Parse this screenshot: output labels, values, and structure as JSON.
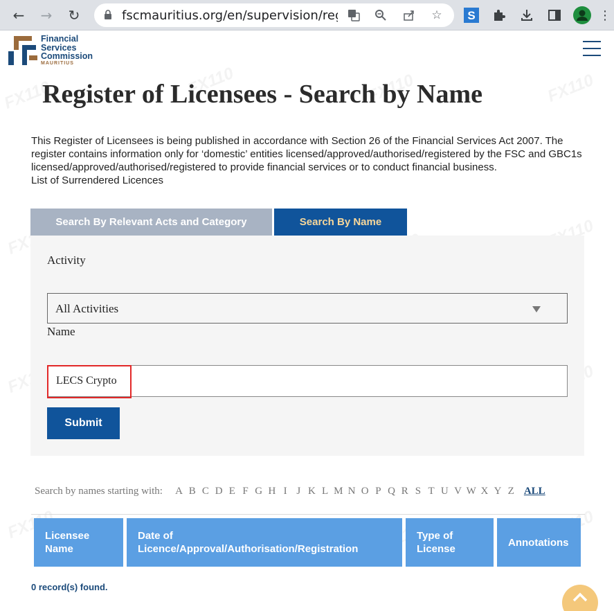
{
  "browser": {
    "url": "fscmauritius.org/en/supervision/reg..."
  },
  "header": {
    "logo_line1": "Financial",
    "logo_line2": "Services",
    "logo_line3": "Commission",
    "logo_sub": "MAURITIUS"
  },
  "page": {
    "title": "Register of Licensees - Search by Name",
    "intro": "This Register of Licensees is being published in accordance with Section 26 of the Financial Services Act 2007. The register contains information only for ‘domestic’ entities licensed/approved/authorised/registered by the FSC and GBC1s licensed/approved/authorised/registered to provide financial services or to conduct financial business.",
    "surrendered_link": "List of Surrendered Licences"
  },
  "tabs": [
    {
      "label": "Search By Relevant Acts and Category"
    },
    {
      "label": "Search By Name"
    }
  ],
  "form": {
    "activity_label": "Activity",
    "activity_value": "All Activities",
    "name_label": "Name",
    "name_value": "LECS Crypto",
    "submit_label": "Submit"
  },
  "alphabet": {
    "prefix": "Search by names starting with:",
    "letters": [
      "A",
      "B",
      "C",
      "D",
      "E",
      "F",
      "G",
      "H",
      "I",
      "J",
      "K",
      "L",
      "M",
      "N",
      "O",
      "P",
      "Q",
      "R",
      "S",
      "T",
      "U",
      "V",
      "W",
      "X",
      "Y",
      "Z"
    ],
    "all_label": "ALL"
  },
  "table": {
    "headers": [
      "Licensee Name",
      "Date of Licence/Approval/Authorisation/Registration",
      "Type of License",
      "Annotations"
    ]
  },
  "results": {
    "count_text": "0 record(s) found."
  },
  "colors": {
    "brand_blue": "#10549b",
    "tab_inactive": "#a8b3c3",
    "tab_active_text": "#f7d79a",
    "table_header": "#5b9fe3",
    "highlight": "#e22727"
  }
}
